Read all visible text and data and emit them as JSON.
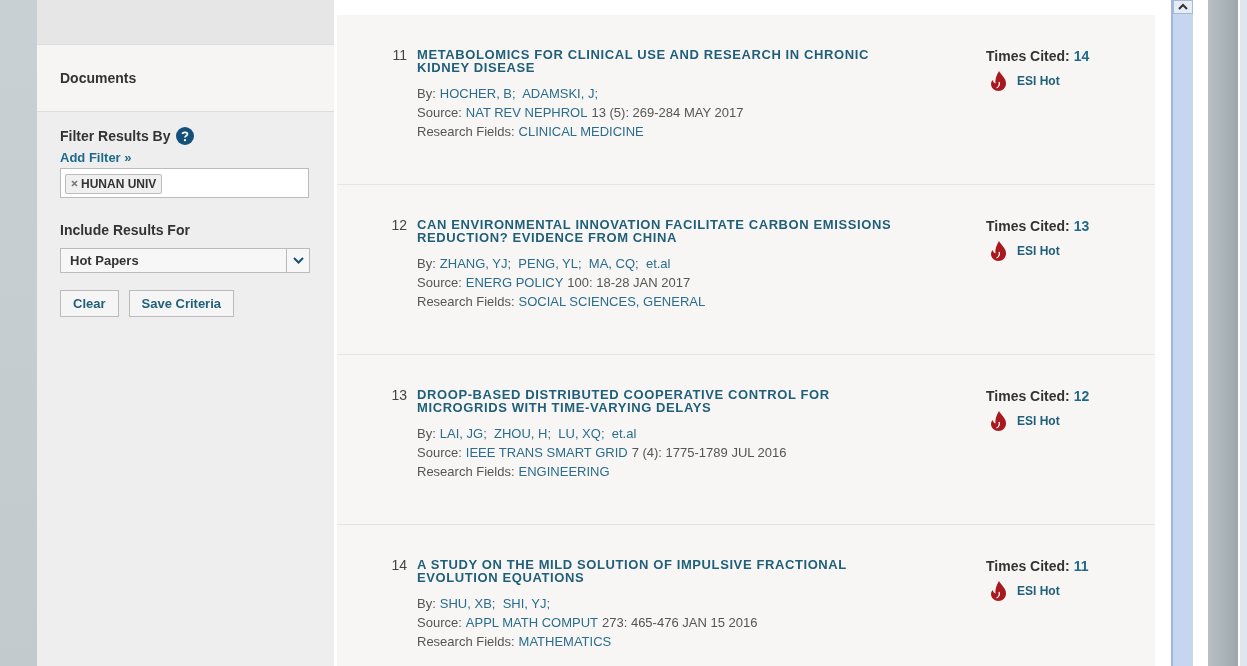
{
  "sidebar": {
    "section_title": "Documents",
    "filter_label": "Filter Results By",
    "add_filter": "Add Filter »",
    "filter_tags": [
      "HUNAN UNIV"
    ],
    "include_label": "Include Results For",
    "include_select": "Hot Papers",
    "buttons": [
      "Clear",
      "Save Criteria"
    ]
  },
  "records": [
    {
      "number": "11",
      "title": "METABOLOMICS FOR CLINICAL USE AND RESEARCH IN CHRONIC KIDNEY DISEASE",
      "by_label": "By:",
      "authors": "HOCHER, B;  ADAMSKI, J;",
      "source_label": "Source:",
      "journal": "NAT REV NEPHROL",
      "source_detail": "13 (5): 269-284 MAY 2017",
      "fields_label": "Research Fields:",
      "field": "CLINICAL MEDICINE",
      "cited_label": "Times Cited:",
      "cited": "14",
      "badge": "ESI Hot"
    },
    {
      "number": "12",
      "title": "CAN ENVIRONMENTAL INNOVATION FACILITATE CARBON EMISSIONS REDUCTION? EVIDENCE FROM CHINA",
      "by_label": "By:",
      "authors": "ZHANG, YJ;  PENG, YL;  MA, CQ;  et.al",
      "source_label": "Source:",
      "journal": "ENERG POLICY",
      "source_detail": "100: 18-28 JAN 2017",
      "fields_label": "Research Fields:",
      "field": "SOCIAL SCIENCES, GENERAL",
      "cited_label": "Times Cited:",
      "cited": "13",
      "badge": "ESI Hot"
    },
    {
      "number": "13",
      "title": "DROOP-BASED DISTRIBUTED COOPERATIVE CONTROL FOR MICROGRIDS WITH TIME-VARYING DELAYS",
      "by_label": "By:",
      "authors": "LAI, JG;  ZHOU, H;  LU, XQ;  et.al",
      "source_label": "Source:",
      "journal": "IEEE TRANS SMART GRID",
      "source_detail": "7 (4): 1775-1789 JUL 2016",
      "fields_label": "Research Fields:",
      "field": "ENGINEERING",
      "cited_label": "Times Cited:",
      "cited": "12",
      "badge": "ESI Hot"
    },
    {
      "number": "14",
      "title": "A STUDY ON THE MILD SOLUTION OF IMPULSIVE FRACTIONAL EVOLUTION EQUATIONS",
      "by_label": "By:",
      "authors": "SHU, XB;  SHI, YJ;",
      "source_label": "Source:",
      "journal": "APPL MATH COMPUT",
      "source_detail": "273: 465-476 JAN 15 2016",
      "fields_label": "Research Fields:",
      "field": "MATHEMATICS",
      "cited_label": "Times Cited:",
      "cited": "11",
      "badge": "ESI Hot"
    }
  ]
}
